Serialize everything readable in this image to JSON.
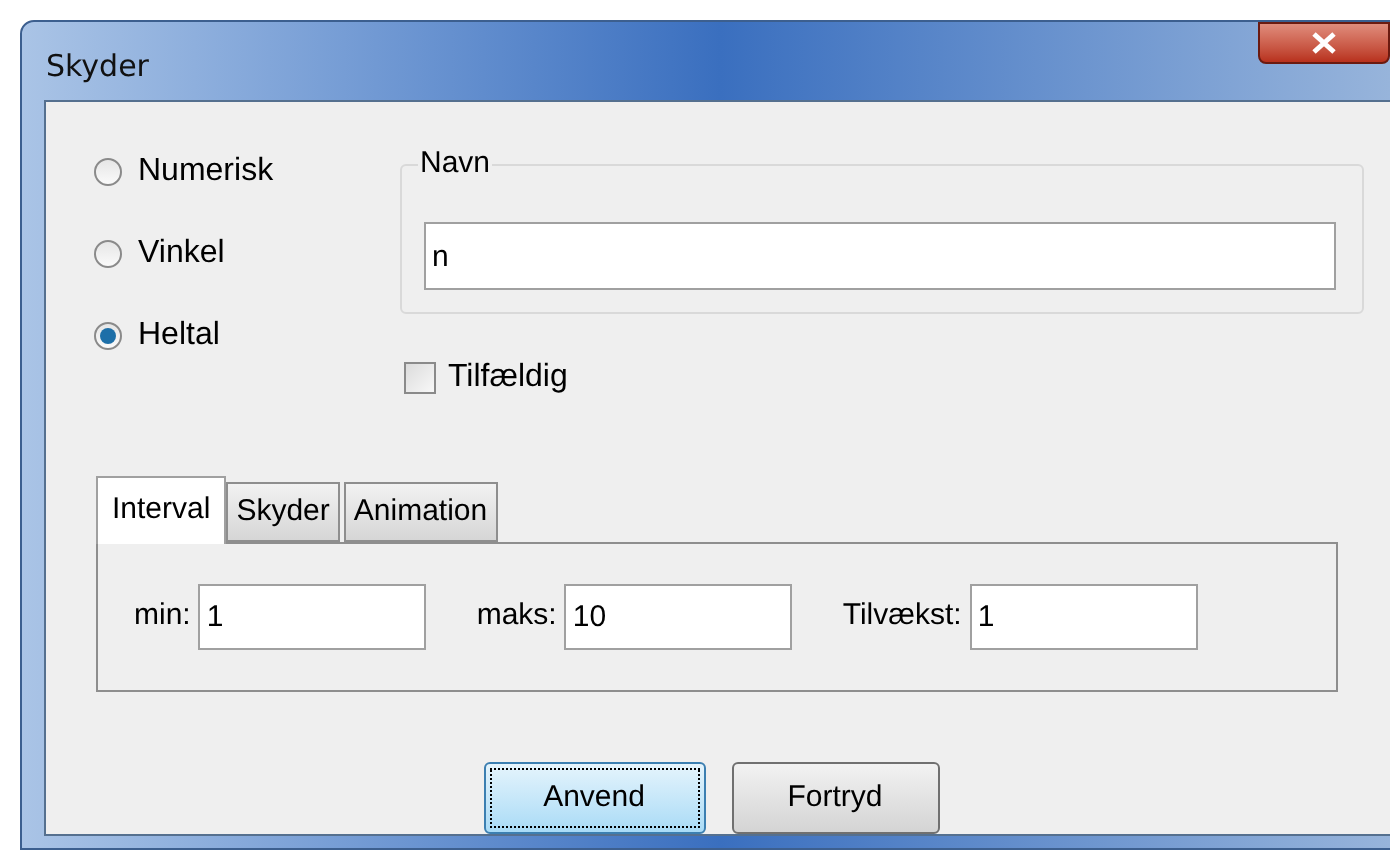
{
  "window": {
    "title": "Skyder"
  },
  "types": [
    {
      "label": "Numerisk",
      "selected": false
    },
    {
      "label": "Vinkel",
      "selected": false
    },
    {
      "label": "Heltal",
      "selected": true
    }
  ],
  "name_group": {
    "title": "Navn",
    "value": "n"
  },
  "random": {
    "label": "Tilfældig",
    "checked": false
  },
  "tabs": [
    {
      "label": "Interval",
      "selected": true
    },
    {
      "label": "Skyder",
      "selected": false
    },
    {
      "label": "Animation",
      "selected": false
    }
  ],
  "interval": [
    {
      "label": "min:",
      "value": "1"
    },
    {
      "label": "maks:",
      "value": "10"
    },
    {
      "label": "Tilvækst:",
      "value": "1"
    }
  ],
  "buttons": [
    {
      "label": "Anvend",
      "focused": true
    },
    {
      "label": "Fortryd",
      "focused": false
    }
  ]
}
